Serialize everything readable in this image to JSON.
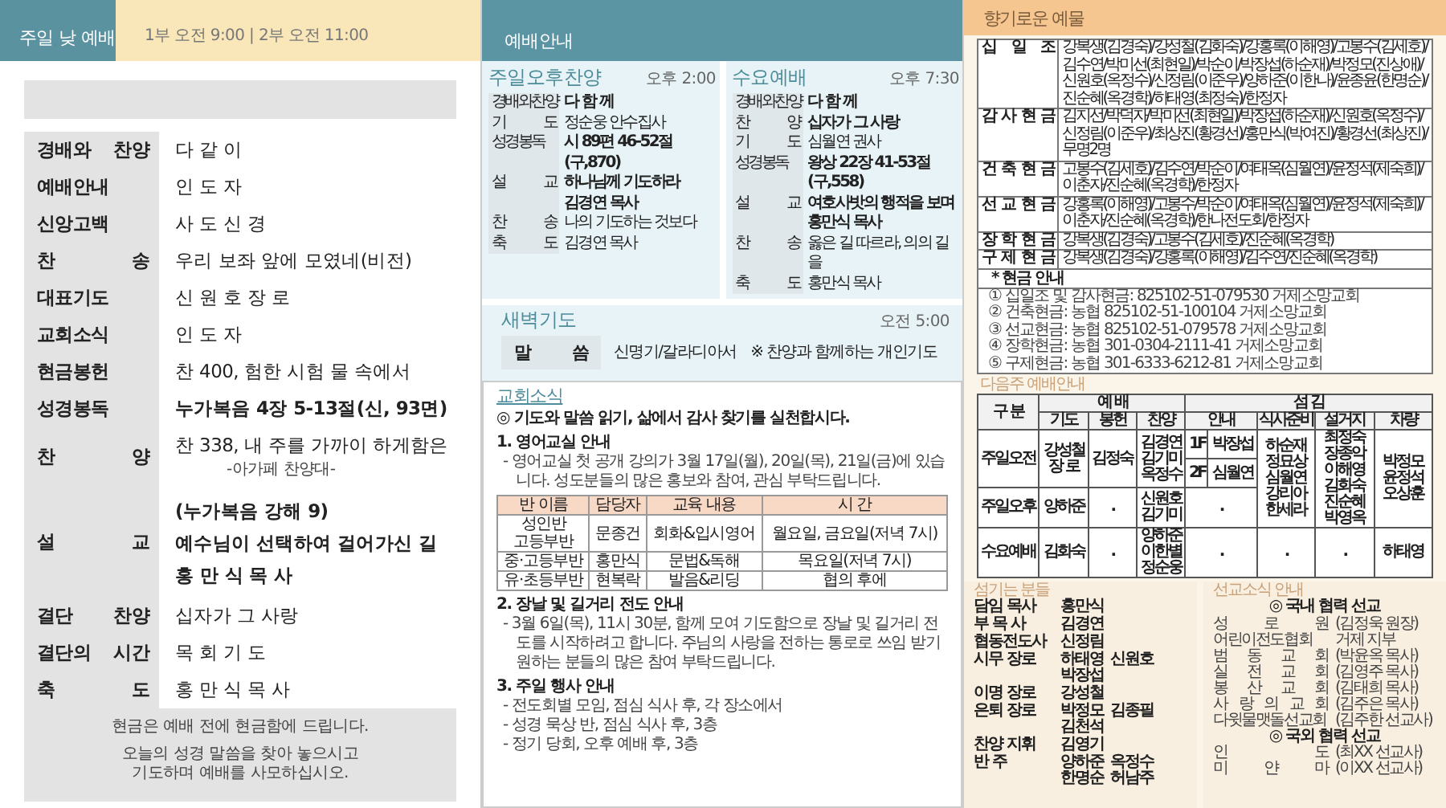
{
  "worship": {
    "title": "주일 낮 예배",
    "time": "1부 오전 9:00 | 2부 오전 11:00",
    "order": [
      {
        "label": "경배와 찬양",
        "lines": [
          "다 같 이"
        ],
        "bold": false
      },
      {
        "label": "예배안내",
        "lines": [
          "인 도 자"
        ],
        "bold": false
      },
      {
        "label": "신앙고백",
        "lines": [
          "사 도 신 경"
        ],
        "bold": false
      },
      {
        "label": "찬 송",
        "lines": [
          "우리 보좌 앞에 모였네(비전)"
        ],
        "bold": false
      },
      {
        "label": "대표기도",
        "lines": [
          "신 원 호 장 로"
        ],
        "bold": false
      },
      {
        "label": "교회소식",
        "lines": [
          "인 도 자"
        ],
        "bold": false
      },
      {
        "label": "현금봉헌",
        "lines": [
          "찬 400, 험한 시험 물 속에서"
        ],
        "bold": false
      },
      {
        "label": "성경봉독",
        "lines": [
          "누가복음 4장 5-13절(신, 93면)"
        ],
        "bold": true
      },
      {
        "label": "찬 양",
        "lines": [
          "찬 338, 내 주를 가까이 하게함은"
        ],
        "note": "-아가페 찬양대-",
        "bold": false
      },
      {
        "label": "설 교",
        "lines": [
          "(누가복음 강해 9)",
          "예수님이 선택하여 걸어가신 길",
          "홍 만 식 목 사"
        ],
        "bold": true
      },
      {
        "label": "결단 찬양",
        "lines": [
          "십자가 그 사랑"
        ],
        "bold": false
      },
      {
        "label": "결단의 시간",
        "lines": [
          "목 회 기 도"
        ],
        "bold": false
      },
      {
        "label": "축 도",
        "lines": [
          "홍 만 식 목 사"
        ],
        "bold": false
      }
    ],
    "notices": [
      {
        "lines": [
          "현금은 예배 전에 현금함에 드립니다."
        ]
      },
      {
        "lines": [
          "오늘의 성경 말씀을 찾아 놓으시고",
          "기도하며 예배를 사모하십시오."
        ]
      }
    ]
  },
  "service_guide": {
    "title": "예배안내",
    "services": [
      {
        "name": "주일오후찬양",
        "time": "오후 2:00",
        "rows": [
          {
            "label": "경배와찬양",
            "lines": [
              "다 함 께"
            ],
            "bold": true
          },
          {
            "label": "기 도",
            "lines": [
              "정순웅 안수집사"
            ],
            "bold": false
          },
          {
            "label": "성경봉독",
            "lines": [
              "시 89편 46-52절(구,870)"
            ],
            "bold": true
          },
          {
            "label": "설 교",
            "lines": [
              "하나님께 기도하라",
              "김경연 목사"
            ],
            "bold": true
          },
          {
            "label": "찬 송",
            "lines": [
              "나의 기도하는 것보다"
            ],
            "bold": false
          },
          {
            "label": "축 도",
            "lines": [
              "김경연 목사"
            ],
            "bold": false
          }
        ]
      },
      {
        "name": "수요예배",
        "time": "오후 7:30",
        "rows": [
          {
            "label": "경배와찬양",
            "lines": [
              "다 함 께"
            ],
            "bold": true
          },
          {
            "label": "찬 양",
            "lines": [
              "십자가 그 사랑"
            ],
            "bold": true
          },
          {
            "label": "기 도",
            "lines": [
              "심월연 권사"
            ],
            "bold": false
          },
          {
            "label": "성경봉독",
            "lines": [
              "왕상 22장 41-53절(구,558)"
            ],
            "bold": true
          },
          {
            "label": "설 교",
            "lines": [
              "여호사밧의 행적을 보며",
              "홍만식 목사"
            ],
            "bold": true
          },
          {
            "label": "찬 송",
            "lines": [
              "옳은 길 따르라, 의의 길을"
            ],
            "bold": false
          },
          {
            "label": "축 도",
            "lines": [
              "홍만식 목사"
            ],
            "bold": false
          }
        ]
      }
    ],
    "dawn": {
      "name": "새벽기도",
      "time": "오전 5:00",
      "label": "말 씀",
      "value": "신명기/갈라디아서",
      "note": "※ 찬양과 함께하는 개인기도"
    }
  },
  "news": {
    "title": "교회소식",
    "headline": "◎ 기도와 말씀 읽기, 삶에서 감사 찾기를 실천합시다.",
    "items": [
      {
        "heading": "1. 영어교실 안내",
        "bullets": [
          "- 영어교실 첫 공개 강의가 3월 17일(월), 20일(목), 21일(금)에 있습니다. 성도분들의 많은 홍보와 참여, 관심 부탁드립니다."
        ],
        "table": {
          "columns": [
            "반 이름",
            "담당자",
            "교육 내용",
            "시 간"
          ],
          "rows": [
            [
              [
                "성인반",
                "고등부반"
              ],
              [
                "문종건"
              ],
              [
                "회화&입시영어"
              ],
              [
                "월요일, 금요일(저녁 7시)"
              ]
            ],
            [
              [
                "중·고등부반"
              ],
              [
                "홍만식"
              ],
              [
                "문법&독해"
              ],
              [
                "목요일(저녁 7시)"
              ]
            ],
            [
              [
                "유·초등부반"
              ],
              [
                "현복락"
              ],
              [
                "발음&리딩"
              ],
              [
                "협의 후에"
              ]
            ]
          ]
        }
      },
      {
        "heading": "2. 장날 및 길거리 전도 안내",
        "bullets": [
          "- 3월 6일(목), 11시 30분, 함께 모여 기도함으로 장날 및 길거리 전도를 시작하려고 합니다. 주님의 사랑을 전하는 통로로 쓰임 받기 원하는 분들의 많은 참여 부탁드립니다."
        ]
      },
      {
        "heading": "3. 주일 행사 안내",
        "bullets": [
          "- 전도회별 모임, 점심 식사 후, 각 장소에서",
          "- 성경 묵상 반, 점심 식사 후, 3층",
          "- 정기 당회, 오후 예배 후, 3층"
        ]
      }
    ]
  },
  "offerings": {
    "title": "향기로운 예물",
    "rows": [
      {
        "label": "십 일 조",
        "names": "강복생(김경숙)/강성철(김화숙)/강홍록(이해영)/고봉수(김세호)/김수연/박미선(최현일)/박순이/박장섭(하순재)/박정모(진상애)/신원호(옥정수)/신정림(이준우)/양하준(이한나)/윤종윤(한명순)/진순혜(옥경학)/하태영(최정숙)/한정자"
      },
      {
        "label": "감 사 현 금",
        "names": "김지선/박덕자/박미선(최현일)/박장섭(하순재)/신원호(옥정수)/신정림(이준우)/최상진(황경선)/홍만식(박여진)/황경선(최상진)/무명2명"
      },
      {
        "label": "건 축 현 금",
        "names": "고봉수(김세호)/김수연/박순이/여태옥(심월연)/윤정석(제숙희)/이춘자/진순혜(옥경학)/한정자"
      },
      {
        "label": "선 교 현 금",
        "names": "강홍록(이해영)/고봉수/박순이/여태옥(심월연)/윤정석(제숙희)/이춘자/진순혜(옥경학)/한나전도회/한정자"
      },
      {
        "label": "장 학 현 금",
        "names": "강복생(김경숙)/고봉수(김세호)/진순혜(옥경학)"
      },
      {
        "label": "구 제 현 금",
        "names": "강복생(김경숙)/강홍록(이해영)/김수연/진순혜(옥경학)"
      }
    ],
    "guide_title": "* 현금 안내",
    "accounts": [
      "① 십일조 및 감사현금: 825102-51-079530 거제소망교회",
      "② 건축현금: 농협 825102-51-100104 거제소망교회",
      "③ 선교현금: 농협 825102-51-079578 거제소망교회",
      "④ 장학현금: 농협 301-0304-2111-41 거제소망교회",
      "⑤ 구제현금: 농협 301-6333-6212-81 거제소망교회"
    ]
  },
  "next_week": {
    "title": "다음주 예배안내",
    "corner": "구 분",
    "groups": [
      "예 배",
      "섬 김"
    ],
    "columns": [
      "기도",
      "봉헌",
      "찬양",
      "안내",
      "식사준비",
      "설거지",
      "차량"
    ],
    "rows": [
      {
        "name": "주일오전",
        "prayer": [
          "강성철",
          "장 로"
        ],
        "offering": [
          "김정숙"
        ],
        "praise": [
          "김경연",
          "김기미",
          "옥정수"
        ],
        "guide": [
          {
            "floor": "1F",
            "name": "박장섭"
          },
          {
            "floor": "2F",
            "name": "심월연"
          }
        ]
      },
      {
        "name": "주일오후",
        "prayer": [
          "양하준"
        ],
        "offering": [
          "."
        ],
        "praise": [
          "신원호",
          "김기미"
        ],
        "guide": [
          {
            "name": "."
          }
        ]
      },
      {
        "name": "수요예배",
        "prayer": [
          "김화숙"
        ],
        "offering": [
          "."
        ],
        "praise": [
          "양하준",
          "이한별",
          "정순웅"
        ],
        "guide": [
          {
            "name": "."
          }
        ],
        "meal": [
          "."
        ],
        "dishes": [
          "."
        ],
        "driver": [
          "하태영"
        ]
      }
    ],
    "shared": {
      "meal": [
        "하순재",
        "정묘상",
        "심월연",
        "강리아",
        "한세라"
      ],
      "dishes": [
        "최정숙",
        "장종악",
        "이해영",
        "김화숙",
        "진순혜",
        "박영옥"
      ],
      "driver": [
        "박정모",
        "윤정석",
        "오상훈"
      ]
    }
  },
  "servers": {
    "title": "섬기는 분들",
    "rows": [
      {
        "role": "담임 목사",
        "names": [
          "홍만식"
        ]
      },
      {
        "role": "부 목 사",
        "names": [
          "김경연"
        ]
      },
      {
        "role": "협동전도사",
        "names": [
          "신정림"
        ]
      },
      {
        "role": "시무 장로",
        "names": [
          "하태영",
          "신원호",
          "박장섭"
        ]
      },
      {
        "role": "이명 장로",
        "names": [
          "강성철"
        ]
      },
      {
        "role": "은퇴 장로",
        "names": [
          "박정모",
          "김종필",
          "김천석"
        ]
      },
      {
        "role": "찬양 지휘",
        "names": [
          "김영기"
        ]
      },
      {
        "role": "반 주",
        "names": [
          "양하준",
          "옥정수",
          "한명순",
          "허남주"
        ]
      }
    ]
  },
  "missions": {
    "title": "선교소식 안내",
    "groups": [
      {
        "heading": "◎ 국내 협력 선교",
        "items": [
          {
            "name": "성 로 원",
            "detail": "(김정욱 원장)"
          },
          {
            "name": "어린이전도협회",
            "detail": "거제 지부"
          },
          {
            "name": "범 동 교 회",
            "detail": "(박윤옥 목사)"
          },
          {
            "name": "실 전 교 회",
            "detail": "(김영주 목사)"
          },
          {
            "name": "봉 산 교 회",
            "detail": "(김태희 목사)"
          },
          {
            "name": "사 랑 의 교 회",
            "detail": "(김주은 목사)"
          },
          {
            "name": "다윗물맷돌선교회",
            "detail": "(김주한 선교사)"
          }
        ]
      },
      {
        "heading": "◎ 국외 협력 선교",
        "items": [
          {
            "name": "인 도",
            "detail": "(최XX 선교사)"
          },
          {
            "name": "미 얀 마",
            "detail": "(이XX 선교사)"
          }
        ]
      }
    ]
  }
}
